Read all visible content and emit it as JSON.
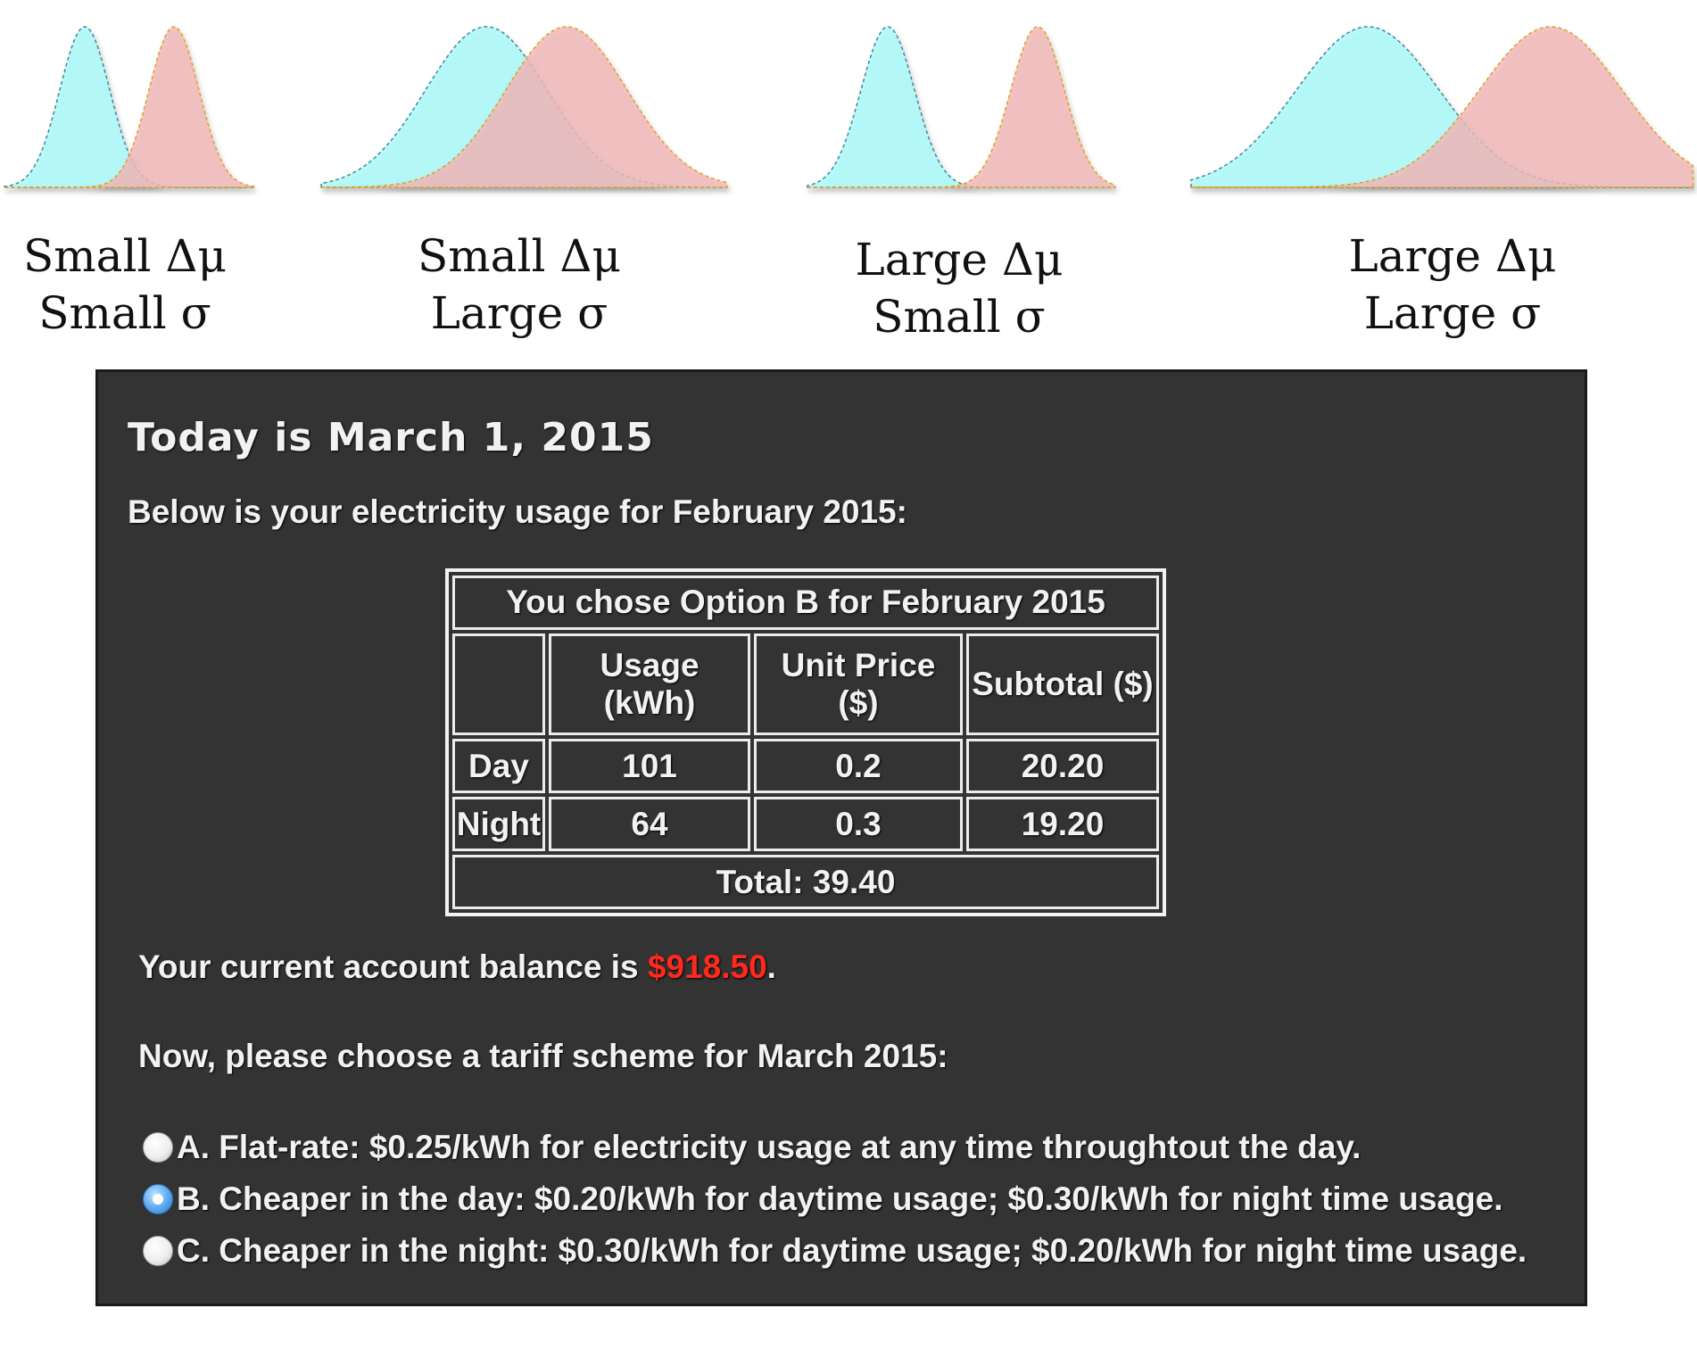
{
  "conditions": [
    {
      "line1": "Small Δμ",
      "line2": "Small σ"
    },
    {
      "line1": "Small Δμ",
      "line2": "Large σ"
    },
    {
      "line1": "Large Δμ",
      "line2": "Small σ"
    },
    {
      "line1": "Large Δμ",
      "line2": "Large σ"
    }
  ],
  "colors": {
    "curve_a_fill": "#a9fafa",
    "curve_b_fill": "#f2b7b8",
    "panel_background": "#333333",
    "balance_highlight": "#ff2a1c",
    "radio_selected": "#3b8fe0"
  },
  "panel": {
    "title": "Today is March 1, 2015",
    "usage_intro": "Below is your electricity usage for February 2015:",
    "table": {
      "caption": "You chose Option B for February 2015",
      "headers": [
        "",
        "Usage (kWh)",
        "Unit Price ($)",
        "Subtotal ($)"
      ],
      "rows": [
        [
          "Day",
          "101",
          "0.2",
          "20.20"
        ],
        [
          "Night",
          "64",
          "0.3",
          "19.20"
        ]
      ],
      "total": "Total: 39.40"
    },
    "balance_prefix": "Your current account balance is ",
    "balance_value": "$918.50",
    "balance_suffix": ".",
    "tariff_prompt": "Now, please choose a tariff scheme for March 2015:",
    "options": [
      {
        "label": "A. Flat-rate: $0.25/kWh for electricity usage at any time throughtout the day.",
        "selected": false
      },
      {
        "label": "B. Cheaper in the day: $0.20/kWh for daytime usage; $0.30/kWh for night time usage.",
        "selected": true
      },
      {
        "label": "C. Cheaper in the night: $0.30/kWh for daytime usage; $0.20/kWh for night time usage.",
        "selected": false
      }
    ]
  }
}
